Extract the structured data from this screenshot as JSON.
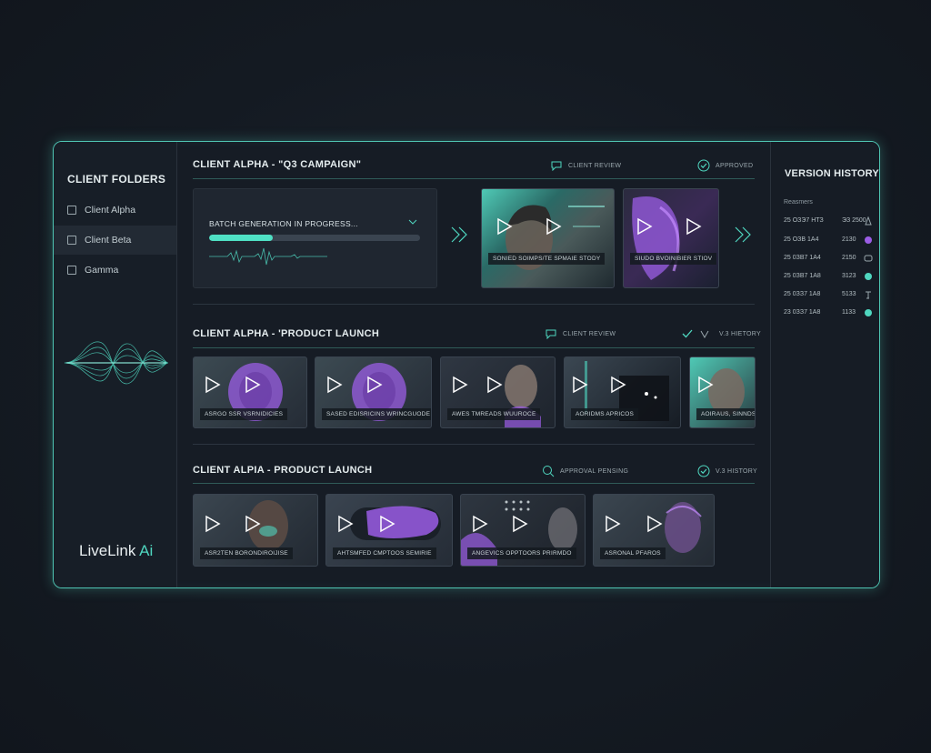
{
  "sidebar": {
    "title": "CLIENT FOLDERS",
    "folders": [
      {
        "label": "Client Alpha"
      },
      {
        "label": "Client Beta"
      },
      {
        "label": "Gamma"
      }
    ],
    "logo": {
      "text": "LiveLink",
      "accent": "Ai"
    }
  },
  "sections": [
    {
      "title": "CLIENT ALPHA - \"Q3 CAMPAIGN\"",
      "review": "CLIENT REVIEW",
      "status": "APPROVED",
      "batch": {
        "label": "BATCH GENERATION IN PROGRESS...",
        "progress": 0.3
      },
      "thumbs": [
        {
          "caption": "SONIED SOIMPS/TE SPMAIE STODY"
        },
        {
          "caption": "SIUDO BVOINIBIER STIOV"
        }
      ]
    },
    {
      "title": "CLIENT ALPHA - 'PRODUCT LAUNCH",
      "review": "CLIENT REVIEW",
      "status": "V.3 HIETORY",
      "thumbs": [
        {
          "caption": "ASRGO SSR VSRNIDICIES"
        },
        {
          "caption": "SASED EDISRICINS WRINCGUODE"
        },
        {
          "caption": "AWES TMREADS WUUROCE"
        },
        {
          "caption": "AORIDMS APRICOS"
        },
        {
          "caption": "AOIRAUS, SINNDS"
        }
      ]
    },
    {
      "title": "CLIENT ALPIA - PRODUCT LAUNCH",
      "review": "APPROVAL PENSING",
      "status": "V.3 HISTORY",
      "thumbs": [
        {
          "caption": "ASR2TEN BORONDIROIJISE"
        },
        {
          "caption": "AHTSMFED CMPTOOS SEMIRIE"
        },
        {
          "caption": "ANGEVICS OPPTOORS PRIRMDO"
        },
        {
          "caption": "ASRONAL PFAROS"
        }
      ]
    }
  ],
  "history": {
    "title": "VERSION HISTORY",
    "subtitle": "Reasmers",
    "rows": [
      {
        "date": "25 ОЗЭ7 НТЗ",
        "time": "ЭЗ 2500",
        "icon": "outline-shape-icon"
      },
      {
        "date": "25 ОЗВ 1А4",
        "time": "2130",
        "icon": "purple-dot-icon"
      },
      {
        "date": "25 0ЗВ7 1А4",
        "time": "2150",
        "icon": "chat-icon"
      },
      {
        "date": "25 0ЗВ7 1А8",
        "time": "3123",
        "icon": "teal-dot-icon"
      },
      {
        "date": "25 0ЗЗ7 1А8",
        "time": "5133",
        "icon": "glyph-icon"
      },
      {
        "date": "23 0ЗЗ7 1А8",
        "time": "1133",
        "icon": "teal-dot-icon"
      }
    ]
  },
  "colors": {
    "accent": "#4fd6bf",
    "purple": "#9b5de5",
    "background": "#141a22"
  }
}
